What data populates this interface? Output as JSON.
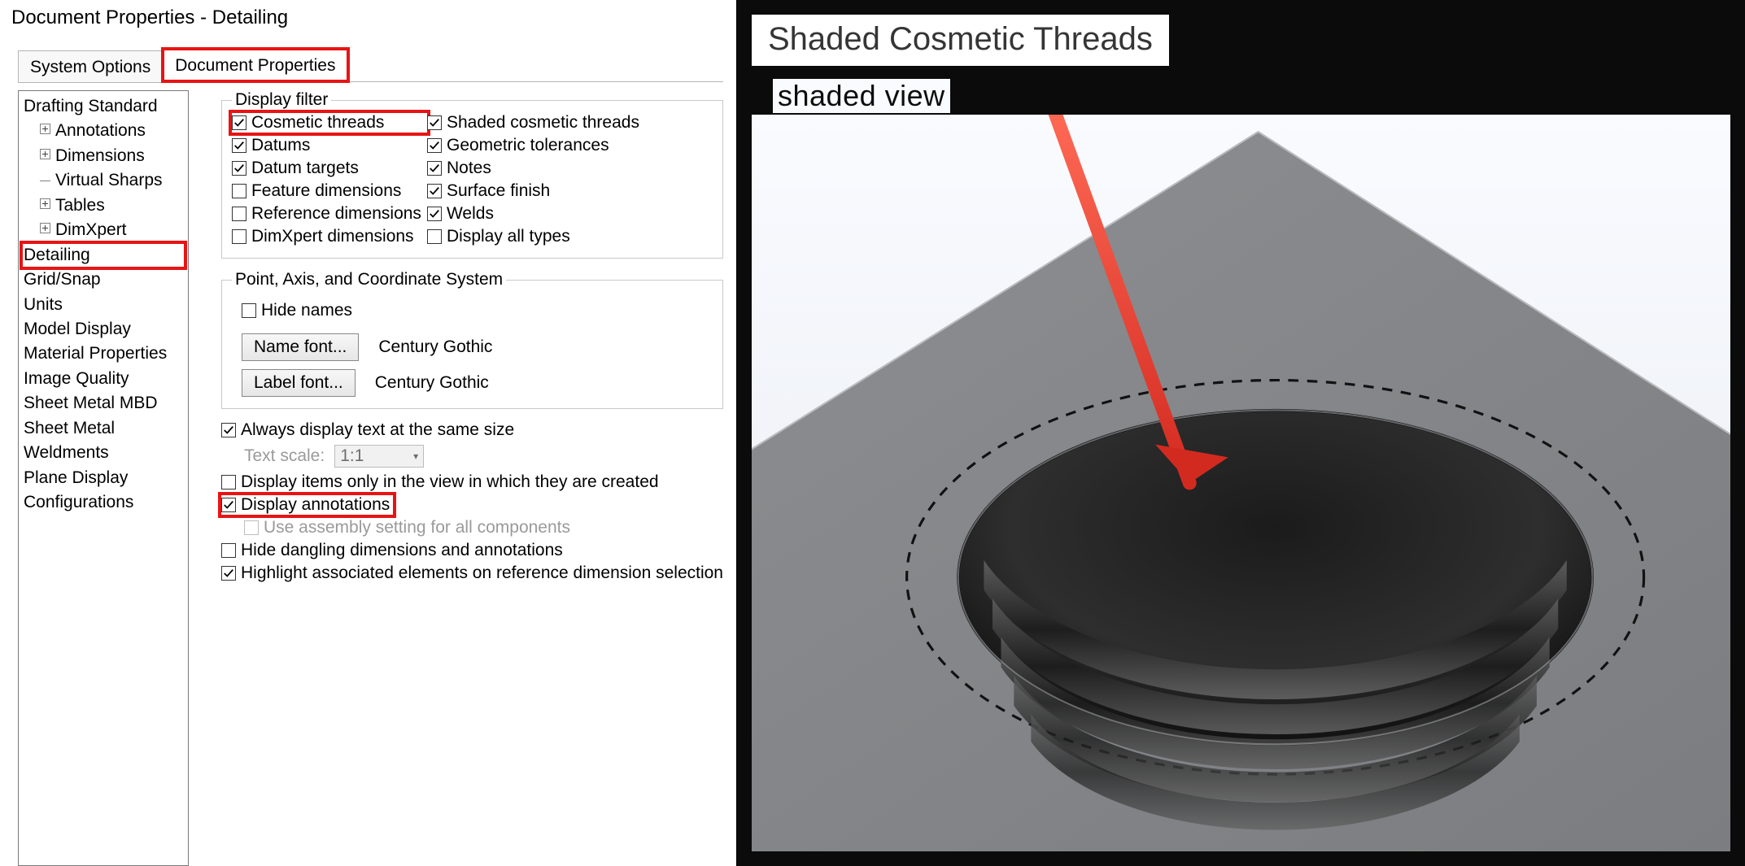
{
  "window": {
    "title": "Document Properties - Detailing"
  },
  "tabs": {
    "system": "System Options",
    "document": "Document Properties",
    "active": "document"
  },
  "tree": {
    "items": [
      {
        "label": "Drafting Standard",
        "level": 0,
        "expand": false
      },
      {
        "label": "Annotations",
        "level": 1,
        "expand": true
      },
      {
        "label": "Dimensions",
        "level": 1,
        "expand": true
      },
      {
        "label": "Virtual Sharps",
        "level": 1,
        "expand": false,
        "leaf": true
      },
      {
        "label": "Tables",
        "level": 1,
        "expand": true
      },
      {
        "label": "DimXpert",
        "level": 1,
        "expand": true
      },
      {
        "label": "Detailing",
        "level": 0,
        "highlight": true
      },
      {
        "label": "Grid/Snap",
        "level": 0
      },
      {
        "label": "Units",
        "level": 0
      },
      {
        "label": "Model Display",
        "level": 0
      },
      {
        "label": "Material Properties",
        "level": 0
      },
      {
        "label": "Image Quality",
        "level": 0
      },
      {
        "label": "Sheet Metal MBD",
        "level": 0
      },
      {
        "label": "Sheet Metal",
        "level": 0
      },
      {
        "label": "Weldments",
        "level": 0
      },
      {
        "label": "Plane Display",
        "level": 0
      },
      {
        "label": "Configurations",
        "level": 0
      }
    ]
  },
  "display_filter": {
    "legend": "Display filter",
    "left": [
      {
        "label": "Cosmetic threads",
        "checked": true,
        "highlight": true
      },
      {
        "label": "Datums",
        "checked": true
      },
      {
        "label": "Datum targets",
        "checked": true
      },
      {
        "label": "Feature dimensions",
        "checked": false
      },
      {
        "label": "Reference dimensions",
        "checked": false
      },
      {
        "label": "DimXpert dimensions",
        "checked": false
      }
    ],
    "right": [
      {
        "label": "Shaded cosmetic threads",
        "checked": true
      },
      {
        "label": "Geometric tolerances",
        "checked": true
      },
      {
        "label": "Notes",
        "checked": true
      },
      {
        "label": "Surface finish",
        "checked": true
      },
      {
        "label": "Welds",
        "checked": true
      },
      {
        "label": "Display all types",
        "checked": false
      }
    ]
  },
  "pacs": {
    "legend": "Point, Axis, and Coordinate System",
    "hide_names": {
      "label": "Hide names",
      "checked": false
    },
    "name_font_btn": "Name font...",
    "label_font_btn": "Label font...",
    "name_font_value": "Century Gothic",
    "label_font_value": "Century Gothic"
  },
  "misc": {
    "always_same_size": {
      "label": "Always display text at the same size",
      "checked": true
    },
    "text_scale_label": "Text scale:",
    "text_scale_value": "1:1",
    "only_in_view": {
      "label": "Display items only in the view in which they are created",
      "checked": false
    },
    "display_annotations": {
      "label": "Display annotations",
      "checked": true,
      "highlight": true
    },
    "use_assembly": {
      "label": "Use assembly setting for all components",
      "checked": false,
      "disabled": true
    },
    "hide_dangling": {
      "label": "Hide dangling dimensions and annotations",
      "checked": false
    },
    "highlight_assoc": {
      "label": "Highlight associated elements on reference dimension selection",
      "checked": true
    }
  },
  "illus": {
    "callout": "Shaded Cosmetic Threads",
    "subline": "shaded view"
  }
}
